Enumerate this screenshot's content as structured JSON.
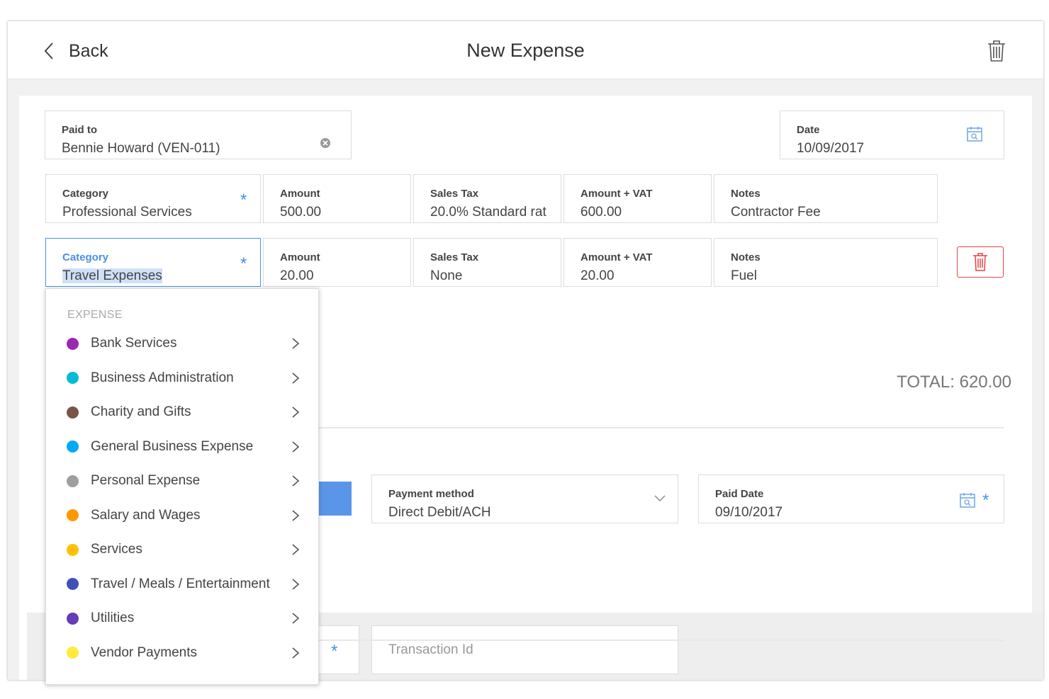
{
  "header": {
    "back_label": "Back",
    "title": "New Expense"
  },
  "paid_to": {
    "label": "Paid to",
    "value": "Bennie Howard (VEN-011)"
  },
  "date": {
    "label": "Date",
    "value": "10/09/2017"
  },
  "line_items": [
    {
      "category_label": "Category",
      "category": "Professional Services",
      "amount_label": "Amount",
      "amount": "500.00",
      "tax_label": "Sales Tax",
      "tax": "20.0% Standard rat",
      "total_label": "Amount + VAT",
      "total": "600.00",
      "notes_label": "Notes",
      "notes": "Contractor Fee"
    },
    {
      "category_label": "Category",
      "category": "Travel Expenses",
      "amount_label": "Amount",
      "amount": "20.00",
      "tax_label": "Sales Tax",
      "tax": "None",
      "total_label": "Amount + VAT",
      "total": "20.00",
      "notes_label": "Notes",
      "notes": "Fuel"
    }
  ],
  "required_mark": "*",
  "total": "TOTAL: 620.00",
  "payment": {
    "method_label": "Payment method",
    "method": "Direct Debit/ACH",
    "paid_date_label": "Paid Date",
    "paid_date": "09/10/2017",
    "transaction_placeholder": "Transaction Id"
  },
  "dropdown": {
    "heading": "EXPENSE",
    "items": [
      {
        "label": "Bank Services",
        "color": "#9c27b0"
      },
      {
        "label": "Business Administration",
        "color": "#00bcd4"
      },
      {
        "label": "Charity and Gifts",
        "color": "#795548"
      },
      {
        "label": "General Business Expense",
        "color": "#03a9f4"
      },
      {
        "label": "Personal Expense",
        "color": "#9e9e9e"
      },
      {
        "label": "Salary and Wages",
        "color": "#ff9800"
      },
      {
        "label": "Services",
        "color": "#ffc107"
      },
      {
        "label": "Travel / Meals / Entertainment",
        "color": "#3f51b5"
      },
      {
        "label": "Utilities",
        "color": "#673ab7"
      },
      {
        "label": "Vendor Payments",
        "color": "#ffeb3b"
      }
    ]
  },
  "colors": {
    "accent": "#4a90e2",
    "danger": "#e04545",
    "selection": "#cfe0f7"
  },
  "icons": {
    "back": "chevron-left-icon",
    "delete": "trash-icon",
    "calendar": "calendar-icon",
    "clear": "clear-icon",
    "expand": "chevron-down-icon",
    "submenu": "chevron-right-icon"
  }
}
